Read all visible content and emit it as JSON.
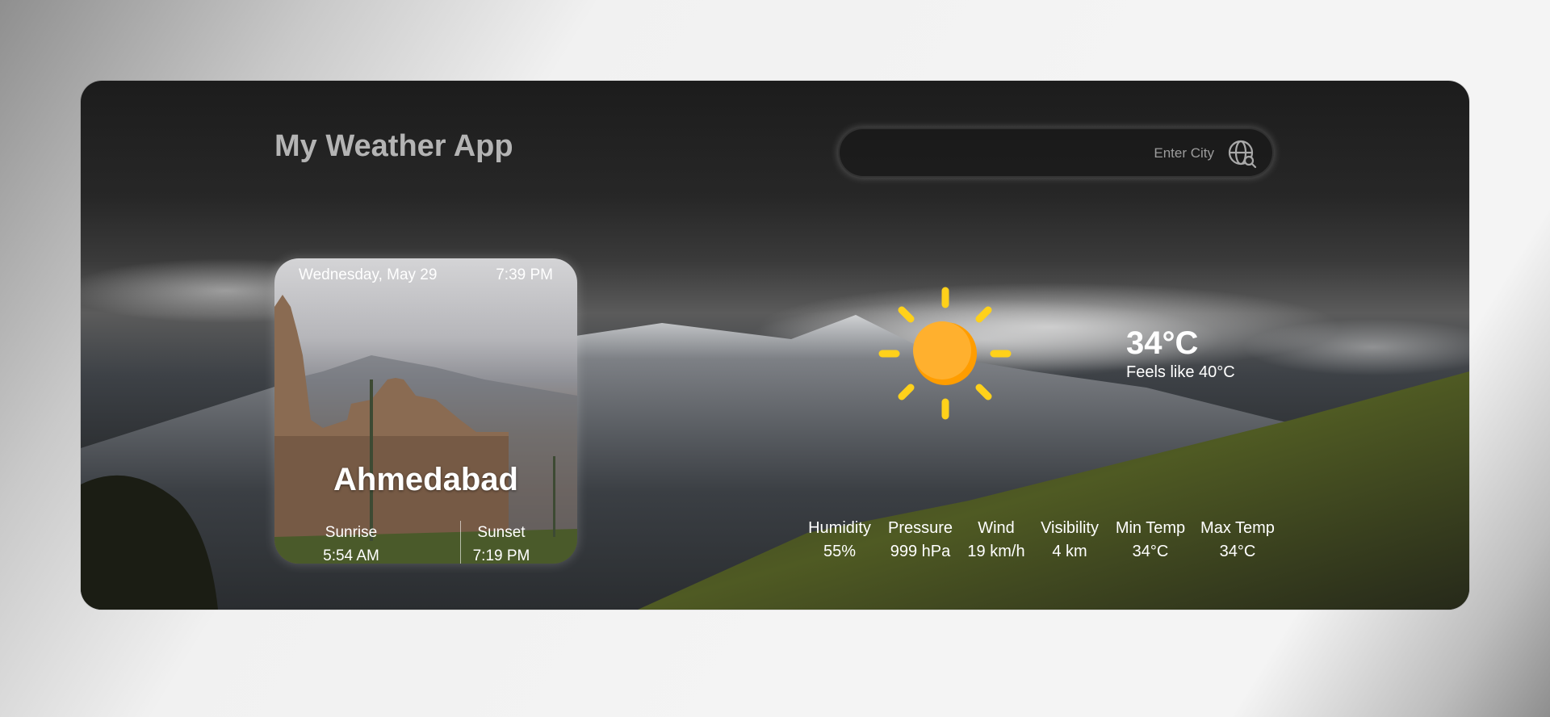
{
  "app": {
    "title": "My Weather App"
  },
  "search": {
    "placeholder": "Enter City",
    "value": ""
  },
  "icons": {
    "search": "globe-search-icon",
    "weather": "sun-icon"
  },
  "card": {
    "date": "Wednesday, May 29",
    "time": "7:39 PM",
    "city": "Ahmedabad",
    "sunrise": {
      "label": "Sunrise",
      "value": "5:54 AM"
    },
    "sunset": {
      "label": "Sunset",
      "value": "7:19 PM"
    }
  },
  "current": {
    "temp": "34°C",
    "feels_like": "Feels like 40°C"
  },
  "stats": [
    {
      "label": "Humidity",
      "value": "55%"
    },
    {
      "label": "Pressure",
      "value": "999 hPa"
    },
    {
      "label": "Wind",
      "value": "19 km/h"
    },
    {
      "label": "Visibility",
      "value": "4 km"
    },
    {
      "label": "Min Temp",
      "value": "34°C"
    },
    {
      "label": "Max Temp",
      "value": "34°C"
    }
  ],
  "colors": {
    "sun": "#ffb02e",
    "sun_rays": "#ffd11a",
    "title": "#b4b4b4"
  }
}
